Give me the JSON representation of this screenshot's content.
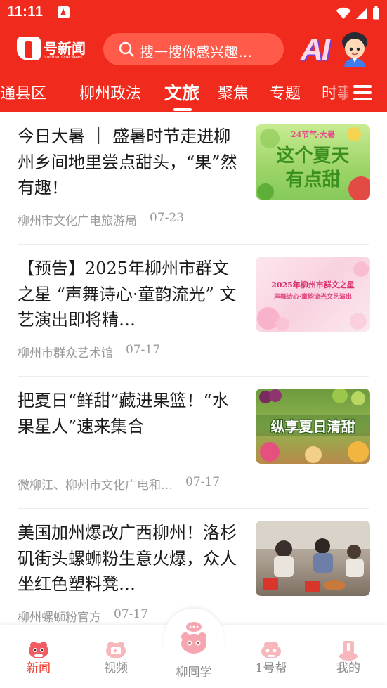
{
  "status_bar": {
    "time": "11:11",
    "icons": [
      "app-notification-icon",
      "wifi-icon",
      "signal-icon",
      "battery-icon"
    ]
  },
  "header": {
    "logo_text": "号新闻",
    "logo_sub": "Number One News",
    "search_placeholder": "搜一搜你感兴趣…",
    "ai_label": "AI"
  },
  "tabs": [
    {
      "label": "直通县区"
    },
    {
      "label": "柳州政法"
    },
    {
      "label": "文旅",
      "active": true
    },
    {
      "label": "聚焦"
    },
    {
      "label": "专题"
    },
    {
      "label": "时事"
    }
  ],
  "news": [
    {
      "title": "今日大暑 ｜ 盛暑时节走进柳州乡间地里尝点甜头，“果”然有趣！",
      "source": "柳州市文化广电旅游局",
      "date": "07-23",
      "thumb_caption": "这个夏天有点甜",
      "thumb_top": "24节气·大暑"
    },
    {
      "title": "【预告】2025年柳州市群文之星 “声舞诗心·童韵流光” 文艺演出即将精…",
      "source": "柳州市群众艺术馆",
      "date": "07-17",
      "thumb_caption": "2025年柳州市群文之星",
      "thumb_sub": "声舞诗心·童韵流光文艺演出"
    },
    {
      "title": "把夏日“鲜甜”藏进果篮！“水果星人”速来集合",
      "source": "微柳江、柳州市文化广电和…",
      "date": "07-17",
      "thumb_caption": "纵享夏日清甜"
    },
    {
      "title": "美国加州爆改广西柳州！洛杉矶街头螺蛳粉生意火爆，众人坐红色塑料凳…",
      "source": "柳州螺蛳粉官方",
      "date": "07-17"
    }
  ],
  "bottom_nav": [
    {
      "label": "新闻",
      "icon": "news-mascot-icon",
      "active": true
    },
    {
      "label": "视频",
      "icon": "video-mascot-icon"
    },
    {
      "label": "柳同学",
      "icon": "assistant-mascot-icon"
    },
    {
      "label": "1号帮",
      "icon": "help-mascot-icon"
    },
    {
      "label": "我的",
      "icon": "profile-mascot-icon"
    }
  ],
  "colors": {
    "brand_red": "#f02a1d",
    "text_dark": "#1a1a1a",
    "text_muted": "#9a9a9a",
    "nav_inactive": "#8a8a8a"
  }
}
